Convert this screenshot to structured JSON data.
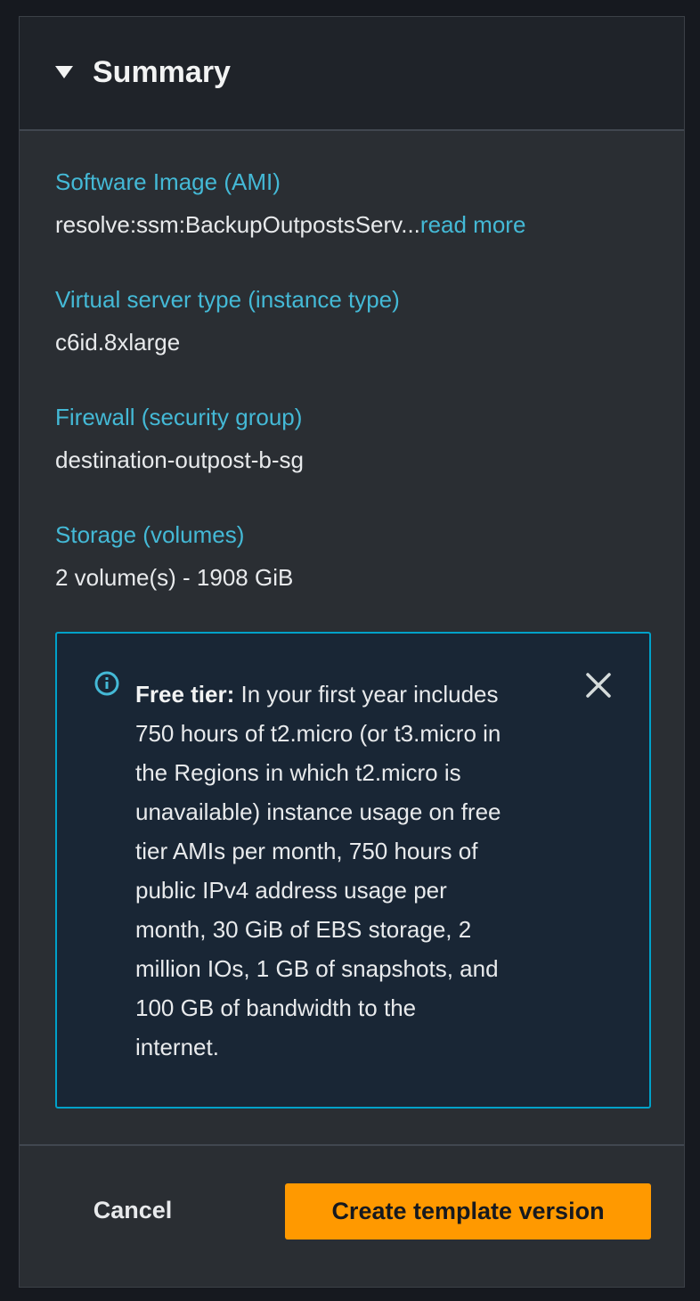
{
  "summary": {
    "title": "Summary",
    "fields": [
      {
        "label": "Software Image (AMI)",
        "value": "resolve:ssm:BackupOutpostsServ...",
        "link": "read more"
      },
      {
        "label": "Virtual server type (instance type)",
        "value": "c6id.8xlarge"
      },
      {
        "label": "Firewall (security group)",
        "value": "destination-outpost-b-sg"
      },
      {
        "label": "Storage (volumes)",
        "value": "2 volume(s) - 1908 GiB"
      }
    ],
    "alert": {
      "heading": "Free tier:",
      "lines": [
        "In your first year includes",
        "750 hours of t2.micro (or t3.micro in",
        "the Regions in which t2.micro is",
        "unavailable) instance usage on free",
        "tier AMIs per month, 750 hours of",
        "public IPv4 address usage per",
        "month, 30 GiB of EBS storage, 2",
        "million IOs, 1 GB of snapshots, and",
        "100 GB of bandwidth to the",
        "internet."
      ],
      "icon": "info-icon",
      "close_icon": "close-icon"
    }
  },
  "footer": {
    "cancel_label": "Cancel",
    "create_label": "Create template version"
  },
  "colors": {
    "accent": "#44b9d6",
    "primary_button": "#ff9900",
    "alert_border": "#00a1c9",
    "alert_background": "#192635",
    "panel_background": "#2a2e33"
  }
}
